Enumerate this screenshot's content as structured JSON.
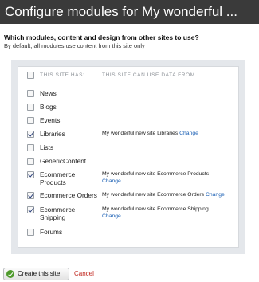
{
  "window": {
    "title": "Configure modules for My wonderful ..."
  },
  "intro": {
    "question": "Which modules, content and design from other sites to use?",
    "subtext": "By default, all modules use content from this site only"
  },
  "table": {
    "header_has": "This site has:",
    "header_use": "This site can use data from...",
    "rows": [
      {
        "name": "News",
        "checked": false,
        "source": "",
        "change": ""
      },
      {
        "name": "Blogs",
        "checked": false,
        "source": "",
        "change": ""
      },
      {
        "name": "Events",
        "checked": false,
        "source": "",
        "change": ""
      },
      {
        "name": "Libraries",
        "checked": true,
        "source": "My wonderful new site Libraries",
        "change": "Change"
      },
      {
        "name": "Lists",
        "checked": false,
        "source": "",
        "change": ""
      },
      {
        "name": "GenericContent",
        "checked": false,
        "source": "",
        "change": ""
      },
      {
        "name": "Ecommerce Products",
        "checked": true,
        "source": "My wonderful new site Ecommerce Products",
        "change": "Change"
      },
      {
        "name": "Ecommerce Orders",
        "checked": true,
        "source": "My wonderful new site Ecommerce Orders",
        "change": "Change"
      },
      {
        "name": "Ecommerce Shipping",
        "checked": true,
        "source": "My wonderful new site Ecommerce Shipping",
        "change": "Change"
      },
      {
        "name": "Forums",
        "checked": false,
        "source": "",
        "change": ""
      }
    ]
  },
  "actions": {
    "create_label": "Create this site",
    "create_icon": "check-circle-icon",
    "cancel_label": "Cancel"
  },
  "colors": {
    "titlebar_bg": "#3a3a3a",
    "link": "#1a5fb4",
    "cancel": "#c0261d",
    "ok_icon": "#4e9a2c"
  }
}
